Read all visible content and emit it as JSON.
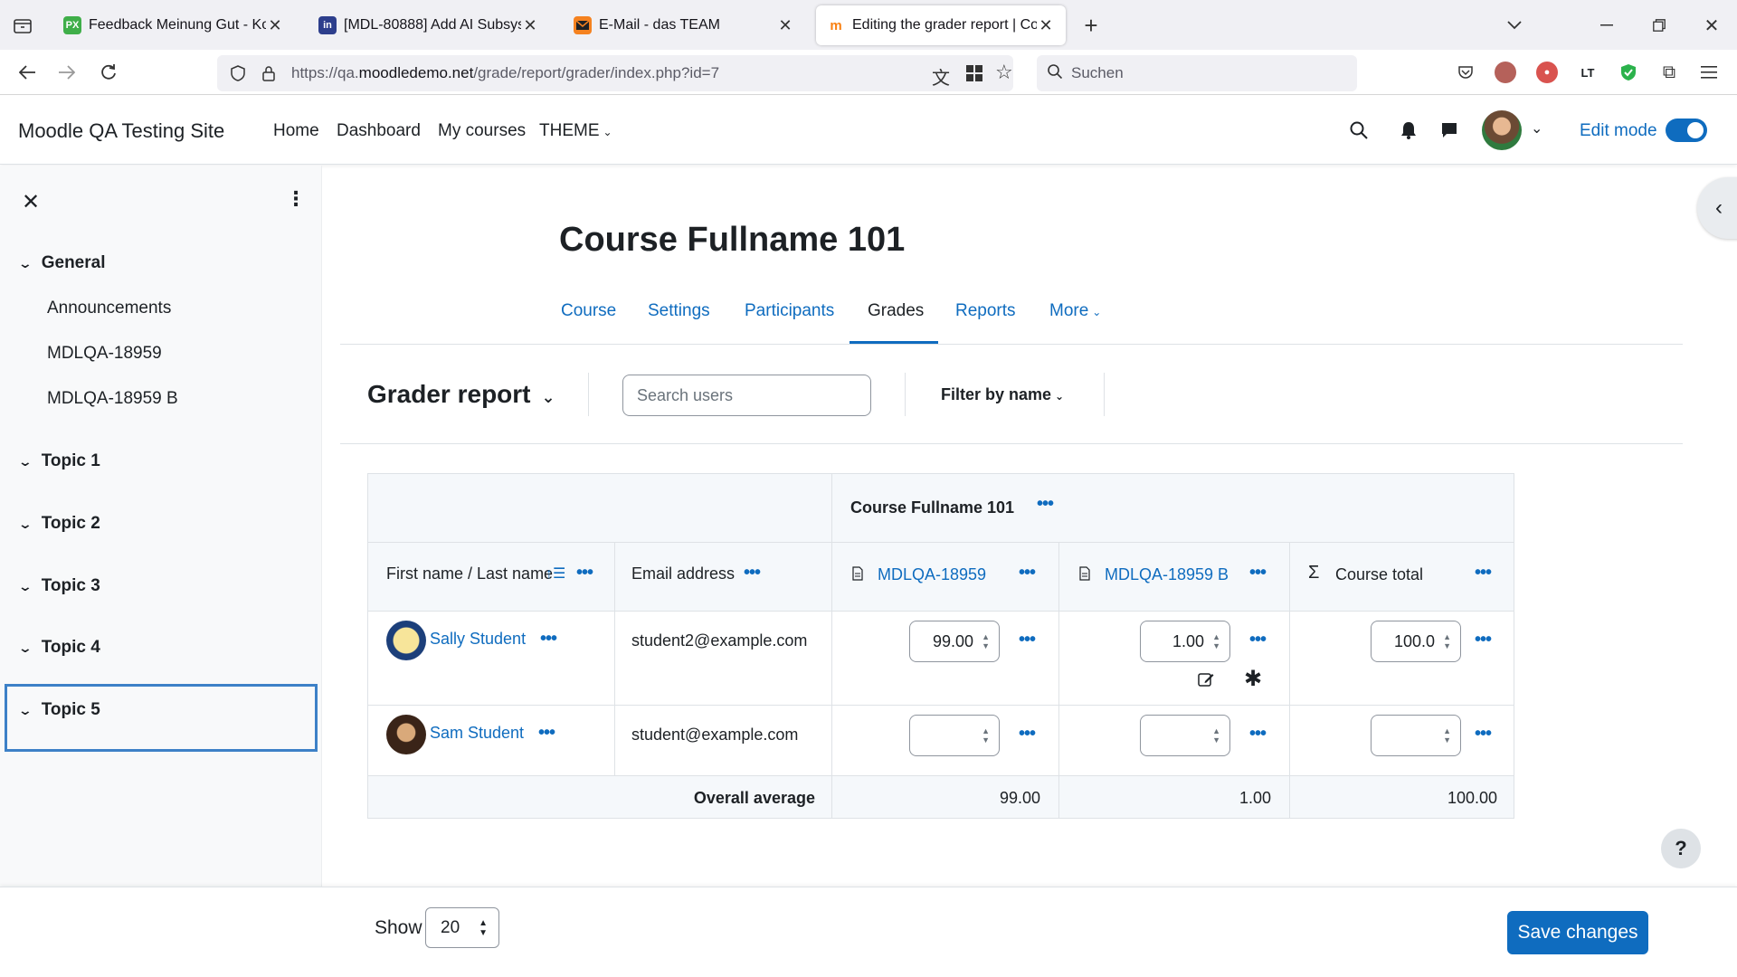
{
  "browser": {
    "tabs": [
      {
        "title": "Feedback Meinung Gut - Kosten",
        "favicon": "PX"
      },
      {
        "title": "[MDL-80888] Add AI Subsystem",
        "favicon": "in"
      },
      {
        "title": "E-Mail - das TEAM",
        "favicon": ""
      },
      {
        "title": "Editing the grader report | Course",
        "favicon": "m"
      }
    ],
    "url_prefix": "https://qa.",
    "url_host": "moodledemo.net",
    "url_path": "/grade/report/grader/index.php?id=7",
    "search_placeholder": "Suchen"
  },
  "navbar": {
    "site_name": "Moodle QA Testing Site",
    "links": [
      "Home",
      "Dashboard",
      "My courses",
      "THEME"
    ],
    "edit_mode_label": "Edit mode"
  },
  "drawer": {
    "sections": [
      {
        "title": "General",
        "activities": [
          "Announcements",
          "MDLQA-18959",
          "MDLQA-18959 B"
        ]
      },
      {
        "title": "Topic 1"
      },
      {
        "title": "Topic 2"
      },
      {
        "title": "Topic 3"
      },
      {
        "title": "Topic 4"
      },
      {
        "title": "Topic 5"
      }
    ]
  },
  "page": {
    "title": "Course Fullname 101",
    "tabs": [
      "Course",
      "Settings",
      "Participants",
      "Grades",
      "Reports",
      "More"
    ],
    "active_tab": "Grades",
    "report_title": "Grader report",
    "search_placeholder": "Search users",
    "filter_label": "Filter by name"
  },
  "grader": {
    "category_header": "Course Fullname 101",
    "col_name": "First name / Last name",
    "col_email": "Email address",
    "col_item1": "MDLQA-18959",
    "col_item2": "MDLQA-18959 B",
    "col_total": "Course total",
    "rows": [
      {
        "name": "Sally Student",
        "email": "student2@example.com",
        "item1": "99.00",
        "item2": "1.00",
        "total": "100.0"
      },
      {
        "name": "Sam Student",
        "email": "student@example.com",
        "item1": "",
        "item2": "",
        "total": ""
      }
    ],
    "avg_label": "Overall average",
    "avg_item1": "99.00",
    "avg_item2": "1.00",
    "avg_total": "100.00"
  },
  "footer": {
    "show_label": "Show",
    "show_value": "20",
    "save_label": "Save changes",
    "help_label": "?"
  },
  "colors": {
    "primary": "#0f6cbf",
    "focus_outline": "#3d81c7"
  }
}
